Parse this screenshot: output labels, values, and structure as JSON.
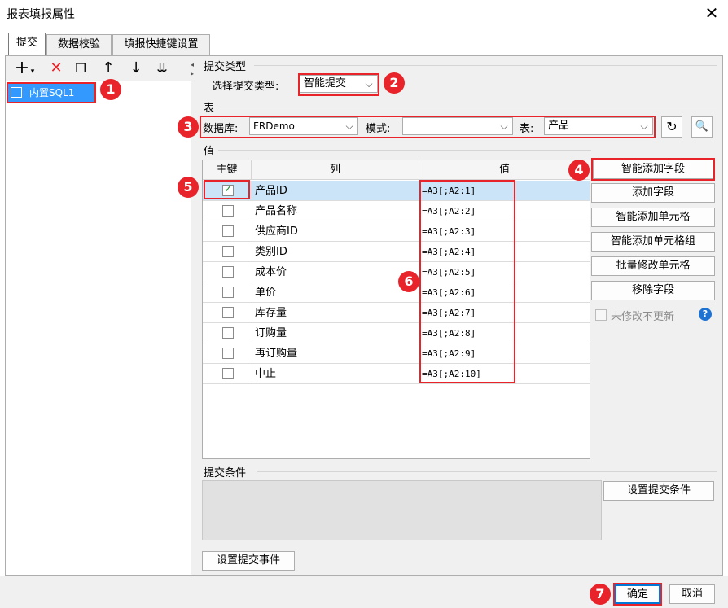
{
  "window": {
    "title": "报表填报属性"
  },
  "tabs": [
    {
      "label": "提交"
    },
    {
      "label": "数据校验"
    },
    {
      "label": "填报快捷键设置"
    }
  ],
  "tree": {
    "items": [
      {
        "label": "内置SQL1"
      }
    ]
  },
  "submit_type": {
    "section_label": "提交类型",
    "field_label": "选择提交类型:",
    "value": "智能提交"
  },
  "table_section": {
    "section_label": "表",
    "database_label": "数据库:",
    "database_value": "FRDemo",
    "mode_label": "模式:",
    "mode_value": "",
    "table_label": "表:",
    "table_value": "产品"
  },
  "values_section": {
    "section_label": "值",
    "headers": {
      "key": "主键",
      "column": "列",
      "value": "值"
    },
    "rows": [
      {
        "key": true,
        "column": "产品ID",
        "value": "=A3[;A2:1]"
      },
      {
        "key": false,
        "column": "产品名称",
        "value": "=A3[;A2:2]"
      },
      {
        "key": false,
        "column": "供应商ID",
        "value": "=A3[;A2:3]"
      },
      {
        "key": false,
        "column": "类别ID",
        "value": "=A3[;A2:4]"
      },
      {
        "key": false,
        "column": "成本价",
        "value": "=A3[;A2:5]"
      },
      {
        "key": false,
        "column": "单价",
        "value": "=A3[;A2:6]"
      },
      {
        "key": false,
        "column": "库存量",
        "value": "=A3[;A2:7]"
      },
      {
        "key": false,
        "column": "订购量",
        "value": "=A3[;A2:8]"
      },
      {
        "key": false,
        "column": "再订购量",
        "value": "=A3[;A2:9]"
      },
      {
        "key": false,
        "column": "中止",
        "value": "=A3[;A2:10]"
      }
    ]
  },
  "side_buttons": {
    "smart_add_field": "智能添加字段",
    "add_field": "添加字段",
    "smart_add_cell": "智能添加单元格",
    "smart_add_cell_group": "智能添加单元格组",
    "batch_modify_cell": "批量修改单元格",
    "remove_field": "移除字段",
    "no_update_unmodified": "未修改不更新"
  },
  "condition": {
    "section_label": "提交条件",
    "set_button": "设置提交条件"
  },
  "event_button": "设置提交事件",
  "footer": {
    "ok": "确定",
    "cancel": "取消"
  },
  "badges": [
    "1",
    "2",
    "3",
    "4",
    "5",
    "6",
    "7"
  ],
  "colors": {
    "accent_red": "#e8232a",
    "selection_blue": "#3399ff",
    "row_selected": "#cce4f7",
    "help_blue": "#1e73d2"
  }
}
